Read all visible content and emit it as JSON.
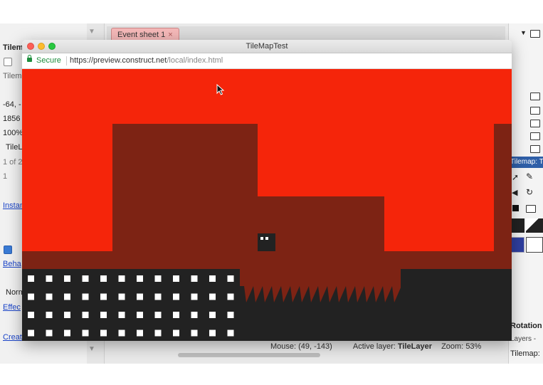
{
  "editor": {
    "left_panel": {
      "header": "Tilem",
      "rows": [
        "Tilem",
        "-64, -",
        "1856",
        "100%",
        "TileL",
        "1 of 2",
        "1"
      ],
      "links": [
        "Instan",
        "Beha",
        "Effec",
        "Creat"
      ],
      "normal_label": "Norm"
    },
    "tab": {
      "label": "Event sheet 1",
      "close": "×"
    },
    "right_panel": {
      "tilemap_header": "Tilemap: T",
      "rotation_label": "Rotation",
      "layers_label": "Layers -",
      "tilemap_footer": "Tilemap:"
    },
    "status": {
      "mouse_label": "Mouse:",
      "mouse_value": "(49, -143)",
      "layer_label": "Active layer:",
      "layer_value": "TileLayer",
      "zoom_label": "Zoom:",
      "zoom_value": "53%"
    }
  },
  "browser": {
    "title": "TileMapTest",
    "secure_label": "Secure",
    "url_host": "https://preview.construct.net",
    "url_path": "/local/index.html"
  },
  "game": {
    "colors": {
      "sky": "#f5250a",
      "rock": "#7d2314",
      "ground": "#222222",
      "tile": "#ffffff"
    },
    "player": "player-block",
    "tile_grid": {
      "rows": 4,
      "cols": 12
    }
  }
}
